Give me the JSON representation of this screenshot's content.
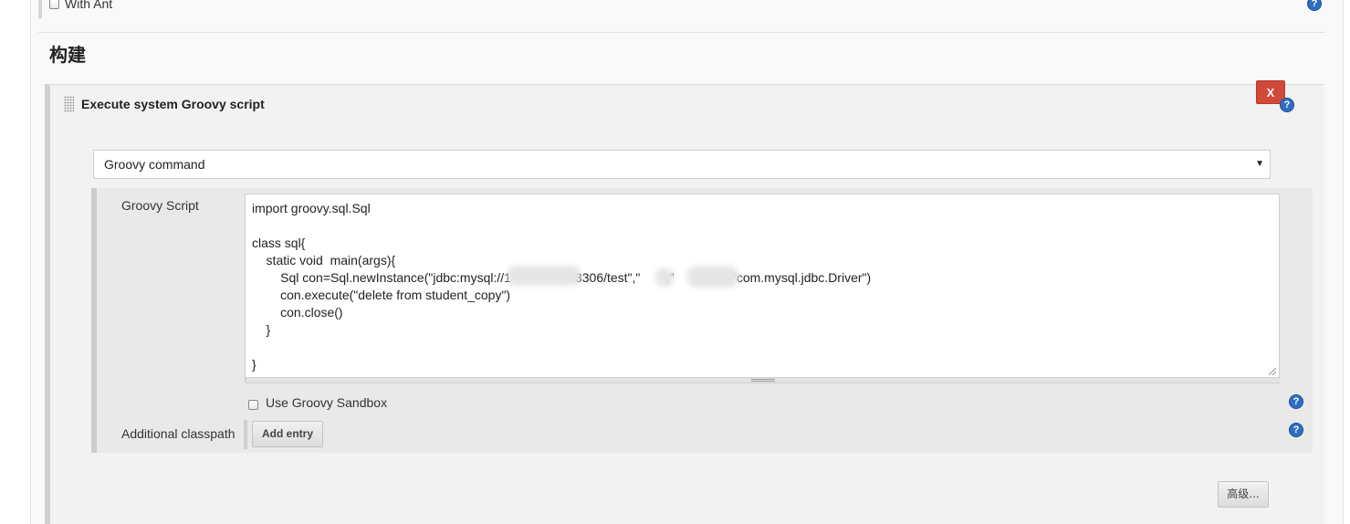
{
  "previous_option": {
    "label": "With Ant"
  },
  "section": {
    "title": "构建"
  },
  "build_step": {
    "title": "Execute system Groovy script",
    "delete_label": "X",
    "mode_select": {
      "selected": "Groovy command"
    },
    "groovy_script": {
      "label": "Groovy Script",
      "value": "import groovy.sql.Sql\n\nclass sql{\n    static void  main(args){\n        Sql con=Sql.newInstance(\"jdbc:mysql://1               7:3306/test\",\"      \",\"              \",\"com.mysql.jdbc.Driver\")\n        con.execute(\"delete from student_copy\")\n        con.close()\n    }\n\n}"
    },
    "sandbox": {
      "label": "Use Groovy Sandbox",
      "checked": false
    },
    "classpath": {
      "label": "Additional classpath",
      "add_entry_label": "Add entry"
    },
    "advanced_label": "高级..."
  },
  "help_icon_glyph": "?",
  "colors": {
    "delete_button": "#d24939",
    "help_icon": "#2e6ec2"
  }
}
